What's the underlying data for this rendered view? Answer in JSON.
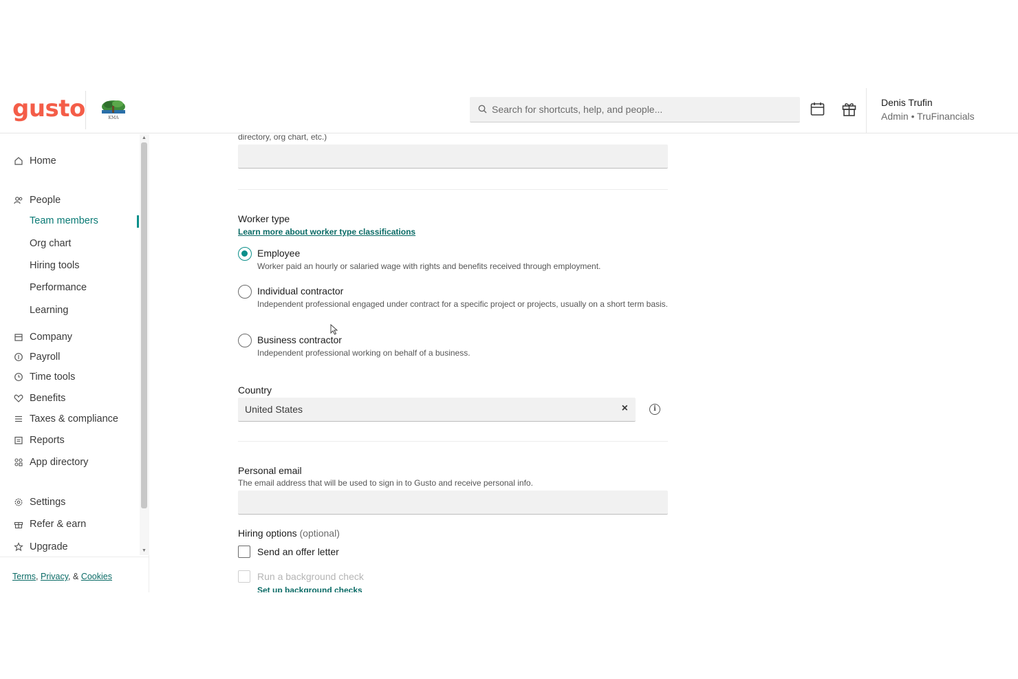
{
  "header": {
    "logo_text": "gusto",
    "search_placeholder": "Search for shortcuts, help, and people...",
    "user_name": "Denis Trufin",
    "user_role": "Admin • TruFinancials"
  },
  "sidebar": {
    "items": [
      {
        "label": "Home",
        "icon": "home-icon"
      },
      {
        "label": "People",
        "icon": "people-icon"
      },
      {
        "label": "Team members",
        "sub": true,
        "active": true
      },
      {
        "label": "Org chart",
        "sub": true
      },
      {
        "label": "Hiring tools",
        "sub": true
      },
      {
        "label": "Performance",
        "sub": true
      },
      {
        "label": "Learning",
        "sub": true
      },
      {
        "label": "Company",
        "icon": "company-icon"
      },
      {
        "label": "Payroll",
        "icon": "payroll-icon"
      },
      {
        "label": "Time tools",
        "icon": "clock-icon"
      },
      {
        "label": "Benefits",
        "icon": "heart-icon"
      },
      {
        "label": "Taxes & compliance",
        "icon": "list-icon"
      },
      {
        "label": "Reports",
        "icon": "reports-icon"
      },
      {
        "label": "App directory",
        "icon": "apps-icon"
      },
      {
        "label": "Settings",
        "icon": "gear-icon"
      },
      {
        "label": "Refer & earn",
        "icon": "gift-icon"
      },
      {
        "label": "Upgrade",
        "icon": "star-icon"
      }
    ],
    "footer": {
      "terms": "Terms",
      "sep1": ", ",
      "privacy": "Privacy",
      "sep2": ", & ",
      "cookies": "Cookies"
    }
  },
  "form": {
    "top_hint": "directory, org chart, etc.)",
    "worker_type": {
      "label": "Worker type",
      "link": "Learn more about worker type classifications",
      "options": [
        {
          "title": "Employee",
          "desc": "Worker paid an hourly or salaried wage with rights and benefits received through employment.",
          "checked": true
        },
        {
          "title": "Individual contractor",
          "desc": "Independent professional engaged under contract for a specific project or projects, usually on a short term basis.",
          "checked": false
        },
        {
          "title": "Business contractor",
          "desc": "Independent professional working on behalf of a business.",
          "checked": false
        }
      ]
    },
    "country": {
      "label": "Country",
      "value": "United States",
      "clear": "×",
      "info": "i"
    },
    "personal_email": {
      "label": "Personal email",
      "hint": "The email address that will be used to sign in to Gusto and receive personal info."
    },
    "hiring_options": {
      "label": "Hiring options",
      "optional": "(optional)",
      "offer_letter": "Send an offer letter",
      "background_check": "Run a background check",
      "background_link": "Set up background checks"
    }
  }
}
